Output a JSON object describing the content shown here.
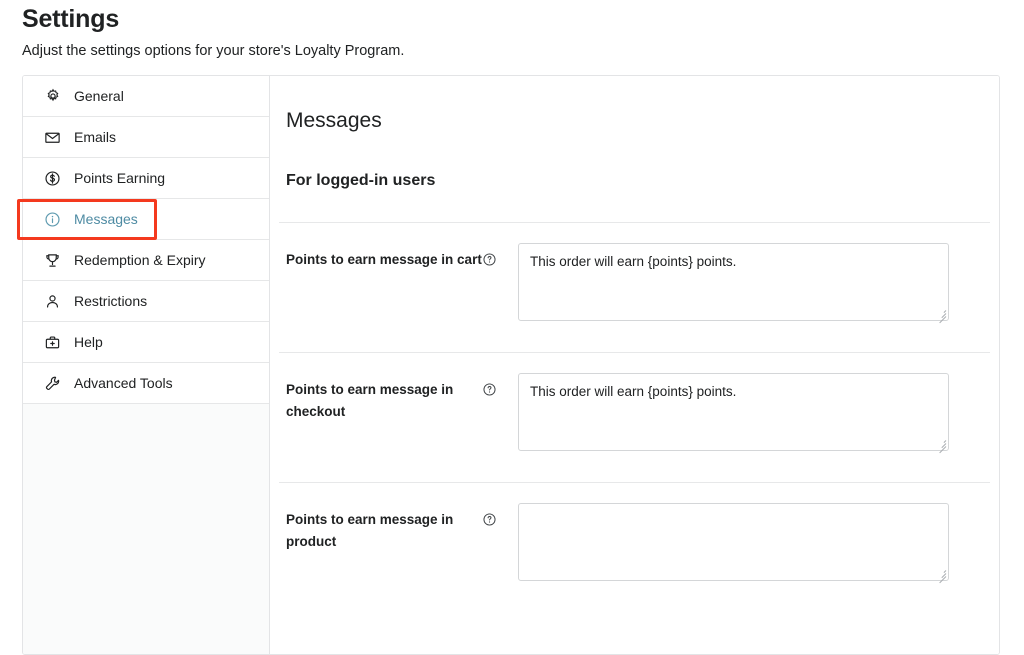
{
  "page": {
    "title": "Settings",
    "subtitle": "Adjust the settings options for your store's Loyalty Program."
  },
  "sidebar": {
    "items": [
      {
        "label": "General",
        "icon": "gear-icon",
        "active": false
      },
      {
        "label": "Emails",
        "icon": "envelope-icon",
        "active": false
      },
      {
        "label": "Points Earning",
        "icon": "dollar-circle-icon",
        "active": false
      },
      {
        "label": "Messages",
        "icon": "info-circle-icon",
        "active": true
      },
      {
        "label": "Redemption & Expiry",
        "icon": "trophy-icon",
        "active": false
      },
      {
        "label": "Restrictions",
        "icon": "person-icon",
        "active": false
      },
      {
        "label": "Help",
        "icon": "first-aid-kit-icon",
        "active": false
      },
      {
        "label": "Advanced Tools",
        "icon": "wrench-icon",
        "active": false
      }
    ]
  },
  "annotation": {
    "target": "Messages",
    "color": "#f4391e"
  },
  "main": {
    "title": "Messages",
    "section_title": "For logged-in users",
    "fields": [
      {
        "label": "Points to earn message in cart",
        "help_icon": "question-circle-icon",
        "value": "This order will earn {points} points.",
        "placeholder": ""
      },
      {
        "label": "Points to earn message in checkout",
        "help_icon": "question-circle-icon",
        "value": "This order will earn {points} points.",
        "placeholder": ""
      },
      {
        "label": "Points to earn message in product",
        "help_icon": "question-circle-icon",
        "value": "",
        "placeholder": ""
      }
    ]
  },
  "colors": {
    "active_nav": "#4e8ba3",
    "annotation": "#f4391e",
    "text": "#202223",
    "border": "#e3e4e6"
  }
}
